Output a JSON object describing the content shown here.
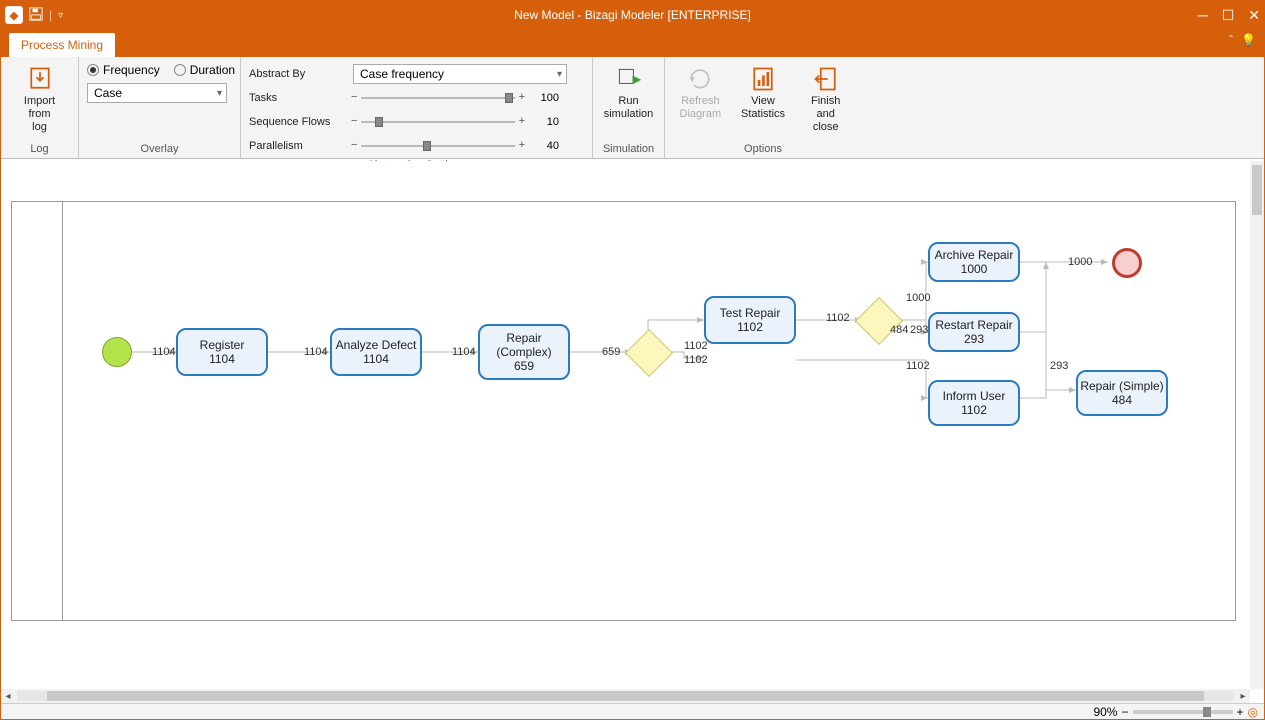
{
  "window": {
    "title": "New Model - Bizagi Modeler [ENTERPRISE]"
  },
  "tabs": {
    "process_mining": "Process Mining"
  },
  "ribbon": {
    "log": {
      "import_label": "Import from\nlog",
      "group_label": "Log"
    },
    "overlay": {
      "frequency": "Frequency",
      "duration": "Duration",
      "case_dropdown": "Case",
      "group_label": "Overlay"
    },
    "abstraction": {
      "abstract_by": "Abstract By",
      "abstract_value": "Case frequency",
      "tasks_label": "Tasks",
      "tasks_value": "100",
      "seq_label": "Sequence Flows",
      "seq_value": "10",
      "par_label": "Parallelism",
      "par_value": "40",
      "group_label": "Abstraction Settings"
    },
    "simulation": {
      "run": "Run\nsimulation",
      "group_label": "Simulation"
    },
    "options": {
      "refresh": "Refresh\nDiagram",
      "view": "View\nStatistics",
      "finish": "Finish and\nclose",
      "group_label": "Options"
    }
  },
  "diagram": {
    "tasks": {
      "register": {
        "name": "Register",
        "count": "1104"
      },
      "analyze": {
        "name": "Analyze Defect",
        "count": "1104"
      },
      "repair_complex": {
        "name": "Repair (Complex)",
        "count": "659"
      },
      "test_repair": {
        "name": "Test Repair",
        "count": "1102"
      },
      "archive": {
        "name": "Archive Repair",
        "count": "1000"
      },
      "restart": {
        "name": "Restart Repair",
        "count": "293"
      },
      "inform": {
        "name": "Inform User",
        "count": "1102"
      },
      "repair_simple": {
        "name": "Repair (Simple)",
        "count": "484"
      }
    },
    "edges": {
      "e1": "1104",
      "e2": "1104",
      "e3": "1104",
      "e4": "659",
      "e5a": "1102",
      "e5b": "1102",
      "e6": "1102",
      "e7": "484",
      "e7b": "293",
      "e8": "1000",
      "e9": "1102",
      "e10": "293",
      "e11": "1000"
    }
  },
  "status": {
    "zoom": "90%"
  }
}
